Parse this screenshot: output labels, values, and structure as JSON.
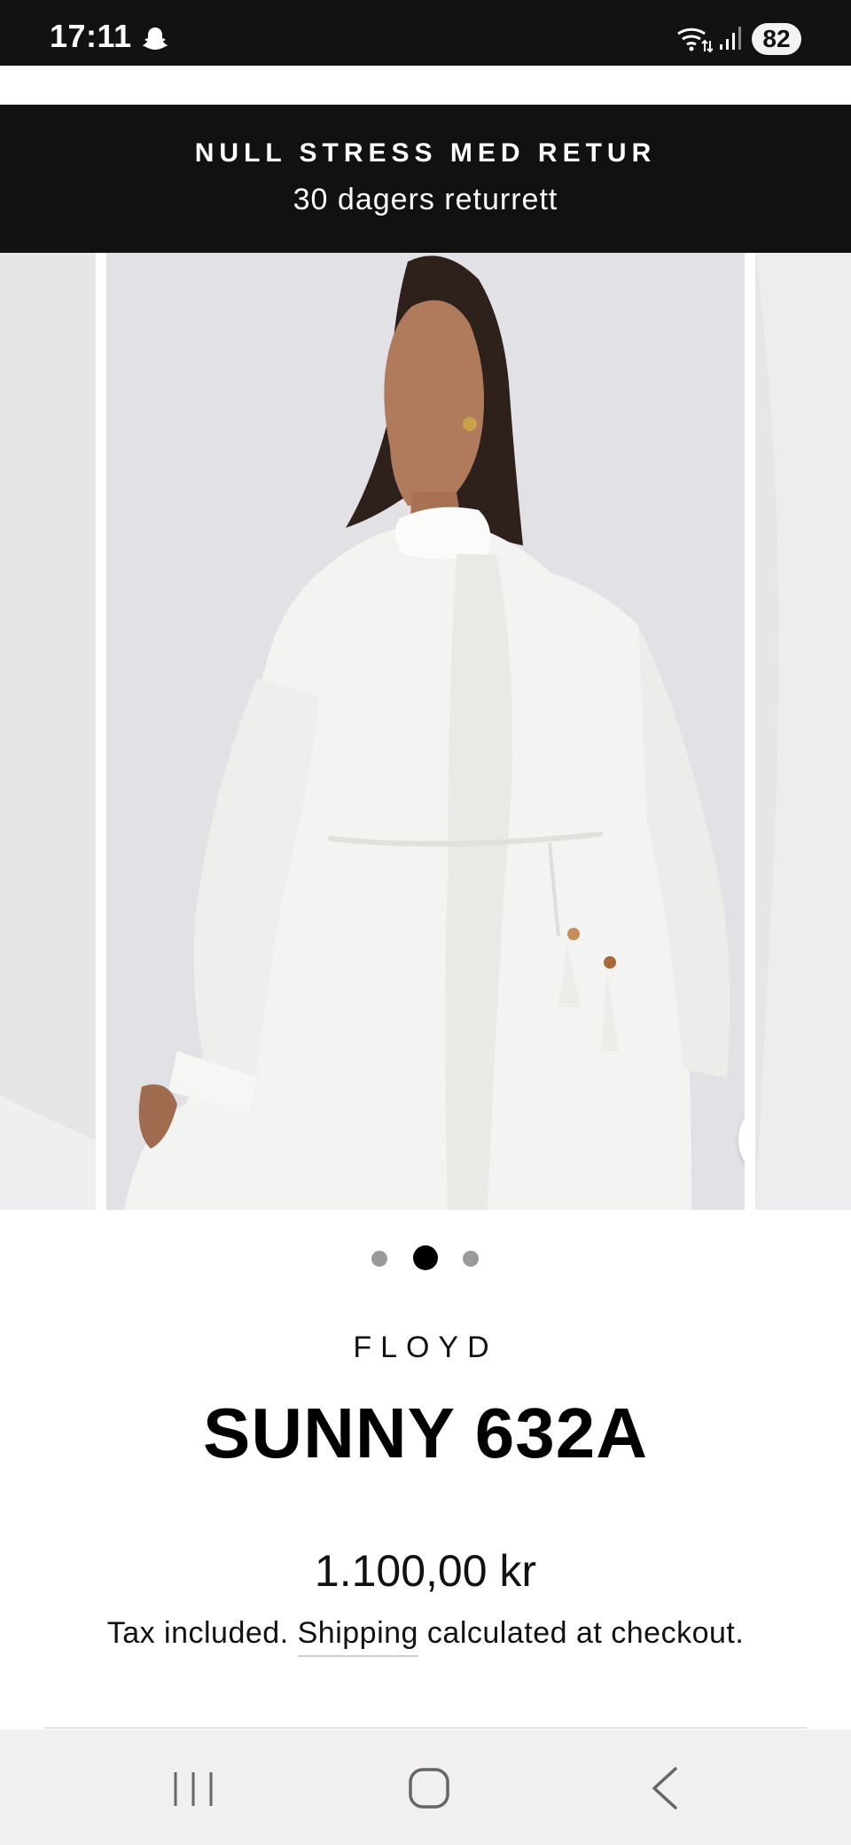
{
  "status_bar": {
    "time": "17:11",
    "battery": "82"
  },
  "announcement": {
    "title": "NULL STRESS MED RETUR",
    "subtitle": "30 dagers returrett"
  },
  "gallery": {
    "slide_count": 3,
    "active_slide": 2
  },
  "product": {
    "vendor": "FLOYD",
    "title": "SUNNY 632A",
    "price": "1.100,00 kr",
    "tax_prefix": "Tax included.",
    "shipping_link": "Shipping",
    "tax_suffix": "calculated at checkout."
  },
  "icons": {
    "zoom": "magnifier-icon",
    "nav_recents": "recents-icon",
    "nav_home": "home-icon",
    "nav_back": "back-icon"
  },
  "colors": {
    "announcement_bg": "#111111",
    "status_bar_bg": "#121212",
    "nav_bar_bg": "#f1eff0"
  }
}
